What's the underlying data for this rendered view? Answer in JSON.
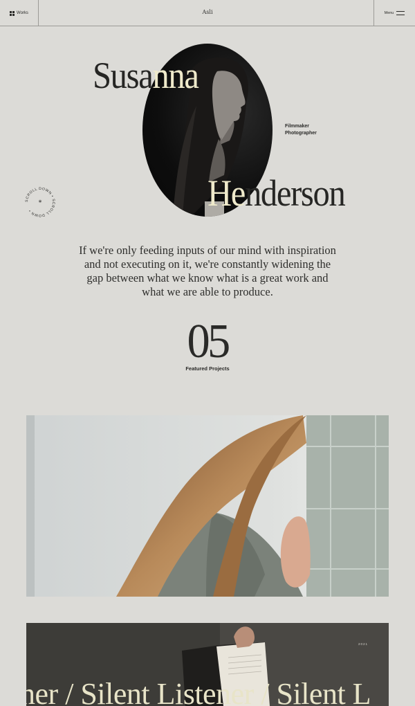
{
  "header": {
    "works_label": "Works",
    "brand": "Asli",
    "menu_label": "Menu"
  },
  "hero": {
    "first_name_dark": "Susa",
    "first_name_light": "nna",
    "last_name_light": "He",
    "last_name_dark": "nderson",
    "roles": [
      "Filmmaker",
      "Photographer"
    ],
    "scroll_badge_text": "SCROLL DOWN • SCROLL DOWN • "
  },
  "quote": "If we're only feeding inputs of our mind with inspiration and not executing on it, we're constantly widening the gap between what we know what is a great work and what we are able to produce.",
  "featured": {
    "count": "05",
    "label": "Featured Projects"
  },
  "projects": [
    {
      "title": "",
      "year": ""
    },
    {
      "title": "ener / Silent Listener / Silent L",
      "year": "2021"
    }
  ],
  "colors": {
    "background": "#dcdbd7",
    "text": "#2a2a28",
    "accent_cream": "#efeacb",
    "lines": "#9c9b97"
  }
}
